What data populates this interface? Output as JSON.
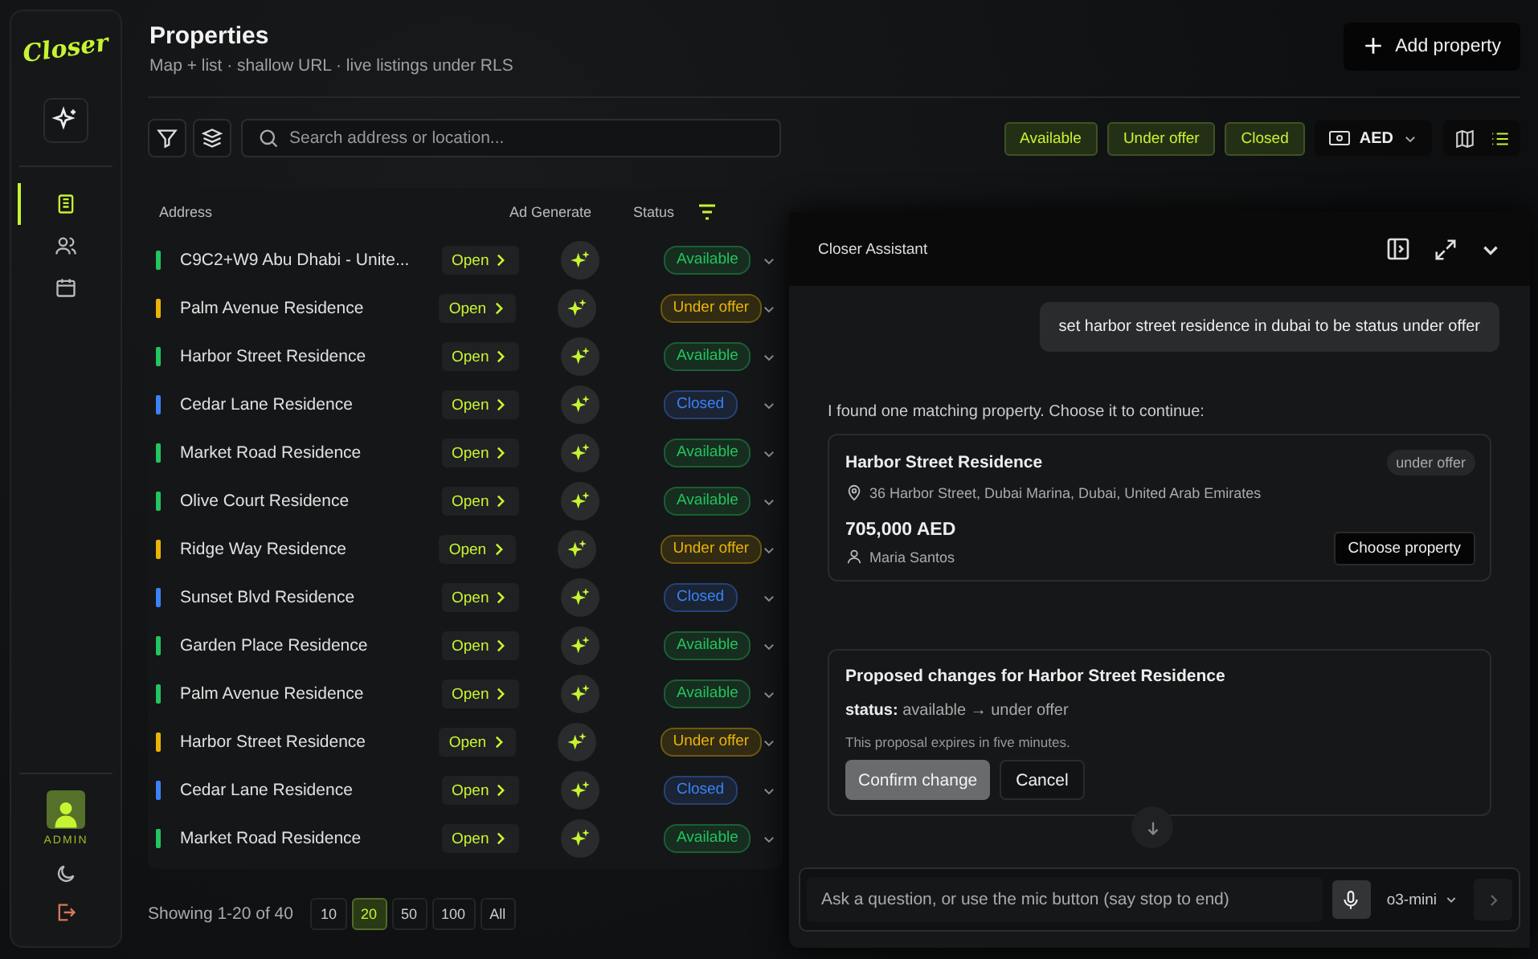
{
  "sidebar": {
    "logo": "Closer",
    "nav": [
      {
        "selected": true
      },
      {
        "selected": false
      },
      {
        "selected": false
      }
    ],
    "user_role": "ADMIN"
  },
  "header": {
    "title": "Properties",
    "subtitle": "Map + list · shallow URL · live listings under RLS",
    "add_button": "Add property"
  },
  "toolbar": {
    "search_placeholder": "Search address or location...",
    "status_filters": [
      {
        "label": "Available",
        "selected": true
      },
      {
        "label": "Under offer",
        "selected": true
      },
      {
        "label": "Closed",
        "selected": true
      }
    ],
    "currency": "AED",
    "views": [
      {
        "kind": "map",
        "selected": false
      },
      {
        "kind": "list",
        "selected": true
      }
    ]
  },
  "table": {
    "columns": [
      "Address",
      "Ad Generate",
      "Status"
    ],
    "rows": [
      {
        "address": "C9C2+W9 Abu Dhabi - Unite...",
        "open": "Open",
        "color": "#22c55e",
        "status_label": "Available"
      },
      {
        "address": "Palm Avenue Residence",
        "open": "Open",
        "color": "#eab308",
        "status_label": "Under offer"
      },
      {
        "address": "Harbor Street Residence",
        "open": "Open",
        "color": "#22c55e",
        "status_label": "Available"
      },
      {
        "address": "Cedar Lane Residence",
        "open": "Open",
        "color": "#3b82f6",
        "status_label": "Closed"
      },
      {
        "address": "Market Road Residence",
        "open": "Open",
        "color": "#22c55e",
        "status_label": "Available"
      },
      {
        "address": "Olive Court Residence",
        "open": "Open",
        "color": "#22c55e",
        "status_label": "Available"
      },
      {
        "address": "Ridge Way Residence",
        "open": "Open",
        "color": "#eab308",
        "status_label": "Under offer"
      },
      {
        "address": "Sunset Blvd Residence",
        "open": "Open",
        "color": "#3b82f6",
        "status_label": "Closed"
      },
      {
        "address": "Garden Place Residence",
        "open": "Open",
        "color": "#22c55e",
        "status_label": "Available"
      },
      {
        "address": "Palm Avenue Residence",
        "open": "Open",
        "color": "#22c55e",
        "status_label": "Available"
      },
      {
        "address": "Harbor Street Residence",
        "open": "Open",
        "color": "#eab308",
        "status_label": "Under offer"
      },
      {
        "address": "Cedar Lane Residence",
        "open": "Open",
        "color": "#3b82f6",
        "status_label": "Closed"
      },
      {
        "address": "Market Road Residence",
        "open": "Open",
        "color": "#22c55e",
        "status_label": "Available"
      }
    ]
  },
  "pagination": {
    "summary": "Showing 1-20 of 40",
    "sizes": [
      {
        "label": "10",
        "selected": false
      },
      {
        "label": "20",
        "selected": true
      },
      {
        "label": "50",
        "selected": false
      },
      {
        "label": "100",
        "selected": false
      },
      {
        "label": "All",
        "selected": false
      }
    ]
  },
  "assistant": {
    "title": "Closer Assistant",
    "user_message": "set harbor street residence in dubai to be status under offer",
    "reply": "I found one matching property. Choose it to continue:",
    "property": {
      "name": "Harbor Street Residence",
      "badge": "under offer",
      "address": "36 Harbor Street, Dubai Marina, Dubai, United Arab Emirates",
      "price": "705,000 AED",
      "agent": "Maria Santos",
      "button": "Choose property"
    },
    "proposal": {
      "title": "Proposed changes for Harbor Street Residence",
      "field": "status:",
      "change": "available → under offer",
      "note": "This proposal expires in five minutes.",
      "confirm": "Confirm change",
      "cancel": "Cancel"
    },
    "input_placeholder": "Ask a question, or use the mic button (say stop to end)",
    "model": "o3-mini"
  }
}
